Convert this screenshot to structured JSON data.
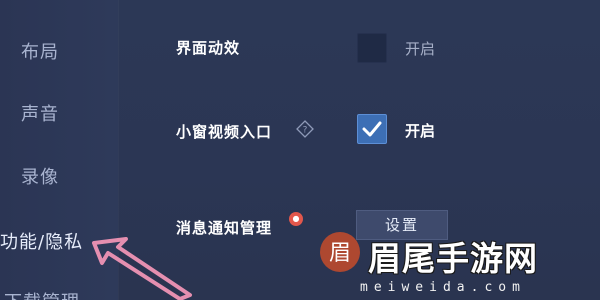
{
  "sidebar": {
    "items": [
      {
        "label": "布局"
      },
      {
        "label": "声音"
      },
      {
        "label": "录像"
      },
      {
        "label": "功能/隐私"
      },
      {
        "label": "下载管理"
      }
    ]
  },
  "settings": {
    "ui_effects": {
      "label": "界面动效",
      "checked": false,
      "state_text": "开启"
    },
    "mini_window": {
      "label": "小窗视频入口",
      "checked": true,
      "state_text": "开启"
    },
    "notifications": {
      "label": "消息通知管理",
      "button_label": "设置"
    }
  },
  "watermark": {
    "logo": "眉",
    "text": "眉尾手游网",
    "url": "meiweida.com"
  },
  "colors": {
    "background": "#2a3653",
    "checkbox_on": "#3d6fb5",
    "arrow": "#e58fb0",
    "badge": "#e2574c"
  },
  "icons": {
    "help": "help-diamond-icon",
    "check": "checkmark-icon",
    "annotation": "pink-arrow-icon"
  }
}
